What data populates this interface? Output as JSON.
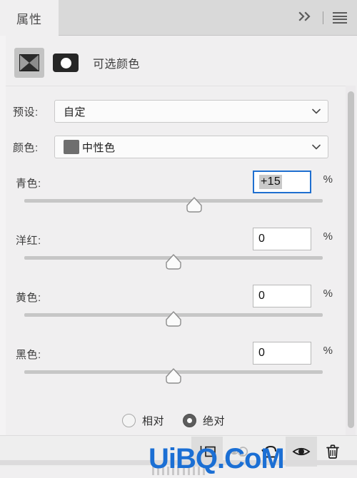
{
  "header": {
    "tab_label": "属性",
    "collapse_icon": "double-chevron-right-icon",
    "menu_icon": "hamburger-menu-icon"
  },
  "adjustment": {
    "icon": "selective-color-adjustment-icon",
    "mask_icon": "layer-mask-thumbnail-icon",
    "title": "可选颜色"
  },
  "fields": {
    "preset": {
      "label": "预设:",
      "value": "自定"
    },
    "colors": {
      "label": "颜色:",
      "value": "中性色",
      "swatch_color": "#6e6e6e"
    }
  },
  "sliders": [
    {
      "label": "青色:",
      "value": "+15",
      "unit": "%",
      "position": 57,
      "focused": true
    },
    {
      "label": "洋红:",
      "value": "0",
      "unit": "%",
      "position": 50,
      "focused": false
    },
    {
      "label": "黄色:",
      "value": "0",
      "unit": "%",
      "position": 50,
      "focused": false
    },
    {
      "label": "黑色:",
      "value": "0",
      "unit": "%",
      "position": 50,
      "focused": false
    }
  ],
  "method": {
    "options": [
      {
        "label": "相对",
        "selected": false
      },
      {
        "label": "绝对",
        "selected": true
      }
    ]
  },
  "footer_tools": [
    {
      "name": "clip-to-layer-icon",
      "state": "pressed"
    },
    {
      "name": "view-previous-state-icon",
      "state": "disabled"
    },
    {
      "name": "reset-icon",
      "state": "normal"
    },
    {
      "name": "toggle-visibility-icon",
      "state": "hover"
    },
    {
      "name": "delete-layer-icon",
      "state": "normal"
    }
  ],
  "watermark": {
    "text": "UiBQ.CoM",
    "color": "#1b6fd4"
  },
  "colors": {
    "accent_focus": "#1f6fd0",
    "panel_bg": "#f0eff0",
    "header_bg": "#d9d9d9"
  }
}
